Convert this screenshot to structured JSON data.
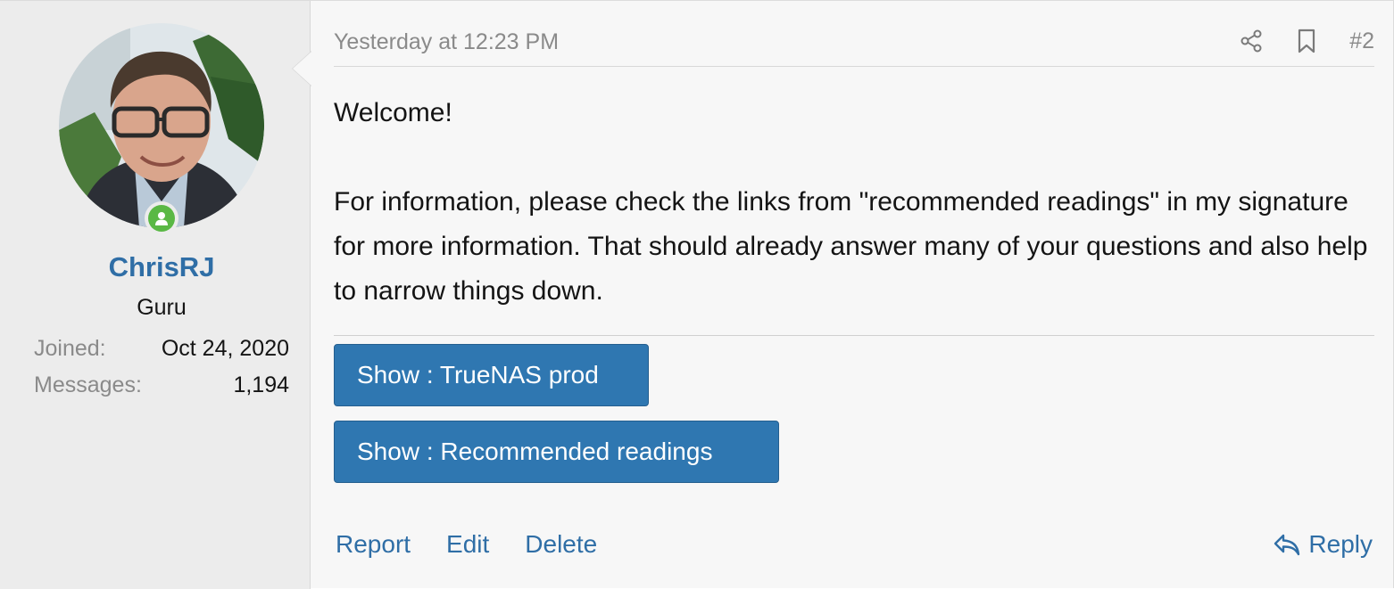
{
  "user": {
    "username": "ChrisRJ",
    "title": "Guru",
    "joined_label": "Joined:",
    "joined_value": "Oct 24, 2020",
    "messages_label": "Messages:",
    "messages_value": "1,194",
    "online_status_color": "#5ab845"
  },
  "post": {
    "timestamp": "Yesterday at 12:23 PM",
    "number": "#2",
    "icons": [
      "share-icon",
      "bookmark-icon"
    ],
    "body": {
      "line1": "Welcome!",
      "line2": "For information, please check the links from \"recommended readings\" in my signature for more information. That should already answer many of your questions and also help to narrow things down."
    },
    "signature": {
      "spoiler1": "Show : TrueNAS prod",
      "spoiler2": "Show : Recommended readings"
    },
    "actions": {
      "report": "Report",
      "edit": "Edit",
      "delete": "Delete",
      "reply": "Reply"
    }
  },
  "colors": {
    "accent": "#2f6ea6",
    "button": "#2f77b1",
    "online": "#5ab845"
  }
}
